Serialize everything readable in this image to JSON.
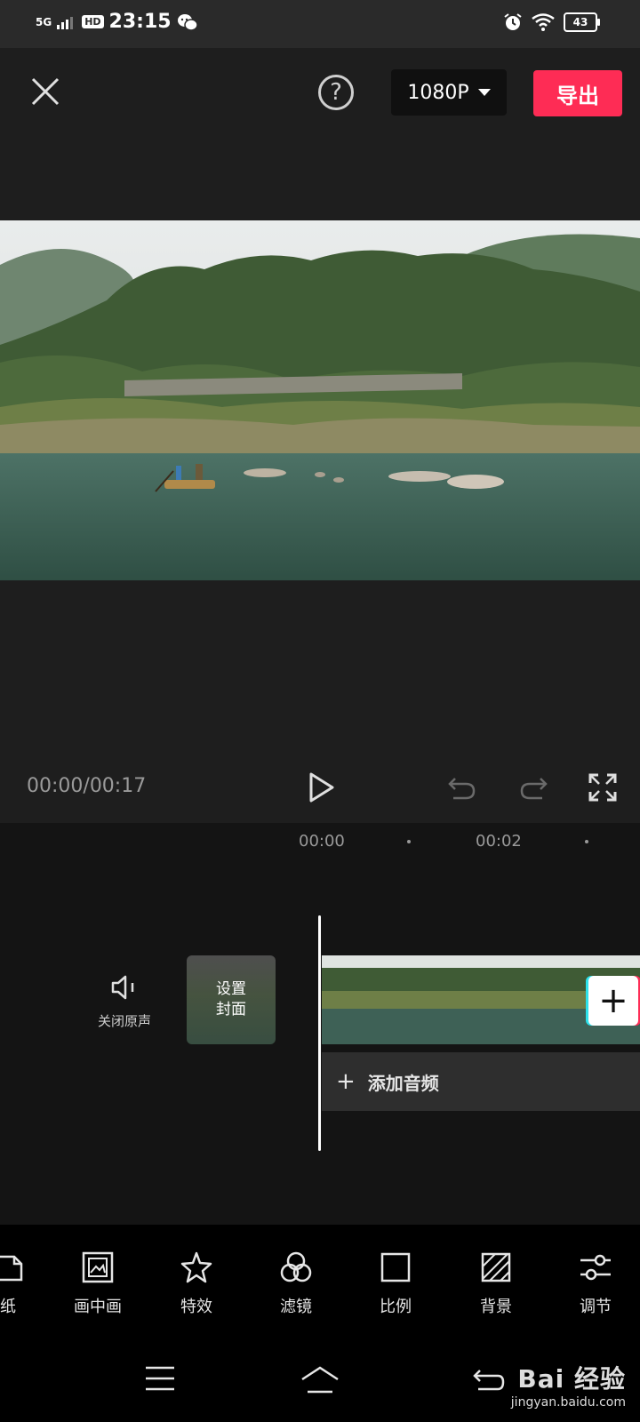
{
  "status_bar": {
    "network": "5G",
    "hd": "HD",
    "time": "23:15",
    "battery": "43"
  },
  "header": {
    "help_label": "?",
    "resolution": "1080P",
    "export_label": "导出"
  },
  "playback": {
    "timecode": "00:00/00:17"
  },
  "timeline": {
    "ruler": [
      "00:00",
      "00:02"
    ],
    "mute_label": "关闭原声",
    "cover_line1": "设置",
    "cover_line2": "封面",
    "add_clip_label": "+",
    "add_audio_label": "添加音频"
  },
  "toolbar": {
    "items": [
      {
        "label": "纸",
        "icon": "sticker-icon"
      },
      {
        "label": "画中画",
        "icon": "picture-in-picture-icon"
      },
      {
        "label": "特效",
        "icon": "effects-star-icon"
      },
      {
        "label": "滤镜",
        "icon": "filter-icon"
      },
      {
        "label": "比例",
        "icon": "ratio-icon"
      },
      {
        "label": "背景",
        "icon": "background-icon"
      },
      {
        "label": "调节",
        "icon": "adjust-sliders-icon"
      }
    ]
  },
  "watermark": {
    "main": "Bai 经验",
    "sub": "jingyan.baidu.com"
  },
  "colors": {
    "accent": "#fe2c55",
    "background": "#1e1e1e",
    "timeline_bg": "#141414",
    "toolbar_bg": "#000000"
  }
}
